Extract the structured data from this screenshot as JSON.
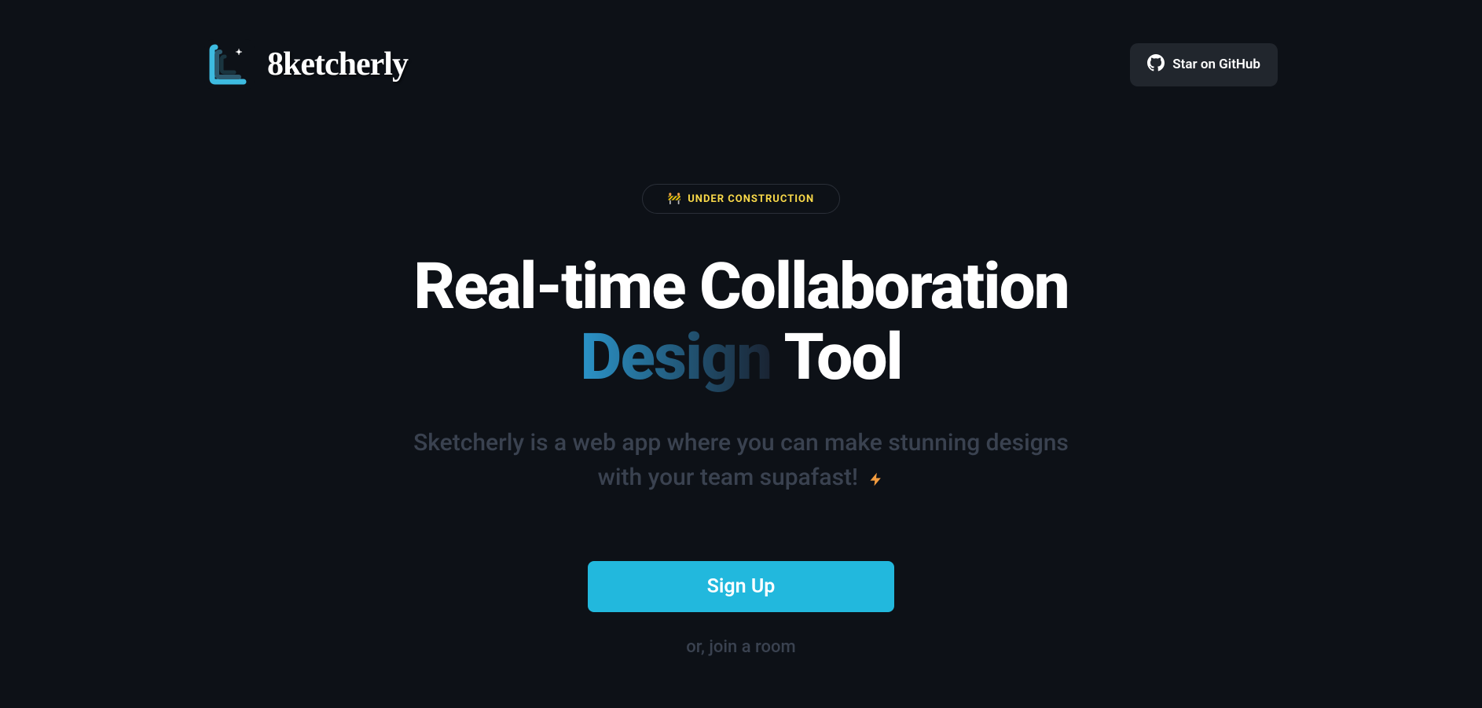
{
  "nav": {
    "brand": "8ketcherly",
    "github_label": "Star on GitHub"
  },
  "hero": {
    "badge_text": "UNDER CONSTRUCTION",
    "headline_line1": "Real-time Collaboration",
    "headline_highlight": "Design",
    "headline_line2_rest": " Tool",
    "subtitle": "Sketcherly is a web app where you can make stunning designs with your team supafast!",
    "signup_label": "Sign Up",
    "join_label": "or, join a room"
  }
}
